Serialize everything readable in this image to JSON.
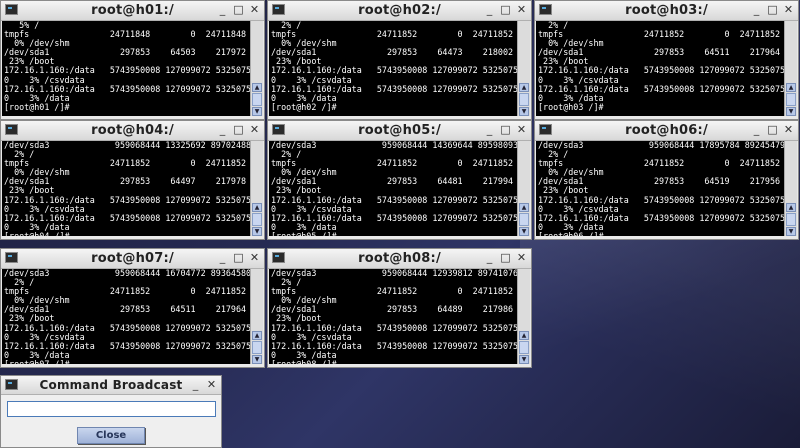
{
  "terminals": [
    {
      "title": "root@h01:/",
      "lines": [
        "   5% /",
        "tmpfs                24711848        0  24711848",
        "  0% /dev/shm",
        "/dev/sda1              297853    64503    217972",
        " 23% /boot",
        "172.16.1.160:/data   5743950008 127099072 532507504",
        "0    3% /csvdata",
        "172.16.1.160:/data   5743950008 127099072 532507504",
        "0    3% /data",
        "[root@h01 /]#"
      ]
    },
    {
      "title": "root@h02:/",
      "lines": [
        "  2% /",
        "tmpfs                24711852        0  24711852",
        "  0% /dev/shm",
        "/dev/sda1              297853    64473    218002",
        " 23% /boot",
        "172.16.1.160:/data   5743950008 127099072 532507504",
        "0    3% /csvdata",
        "172.16.1.160:/data   5743950008 127099072 532507504",
        "0    3% /data",
        "[root@h02 /]#"
      ]
    },
    {
      "title": "root@h03:/",
      "lines": [
        "  2% /",
        "tmpfs                24711852        0  24711852",
        "  0% /dev/shm",
        "/dev/sda1              297853    64511    217964",
        " 23% /boot",
        "172.16.1.160:/data   5743950008 127099072 532507504",
        "0    3% /csvdata",
        "172.16.1.160:/data   5743950008 127099072 532507504",
        "0    3% /data",
        "[root@h03 /]#"
      ]
    },
    {
      "title": "root@h04:/",
      "lines": [
        "/dev/sda3             959068444 13325692 897024888",
        "  2% /",
        "tmpfs                24711852        0  24711852",
        "  0% /dev/shm",
        "/dev/sda1              297853    64497    217978",
        " 23% /boot",
        "172.16.1.160:/data   5743950008 127099072 532507504",
        "0    3% /csvdata",
        "172.16.1.160:/data   5743950008 127099072 532507504",
        "0    3% /data",
        "[root@h04 /]#"
      ]
    },
    {
      "title": "root@h05:/",
      "lines": [
        "/dev/sda3             959068444 14369644 895980936",
        "  2% /",
        "tmpfs                24711852        0  24711852",
        "  0% /dev/shm",
        "/dev/sda1              297853    64481    217994",
        " 23% /boot",
        "172.16.1.160:/data   5743950008 127099072 532507504",
        "0    3% /csvdata",
        "172.16.1.160:/data   5743950008 127099072 532507504",
        "0    3% /data",
        "[root@h05 /]#"
      ]
    },
    {
      "title": "root@h06:/",
      "lines": [
        "/dev/sda3             959068444 17895784 892454796",
        "  2% /",
        "tmpfs                24711852        0  24711852",
        "  0% /dev/shm",
        "/dev/sda1              297853    64519    217956",
        " 23% /boot",
        "172.16.1.160:/data   5743950008 127099072 532507504",
        "0    3% /csvdata",
        "172.16.1.160:/data   5743950008 127099072 532507504",
        "0    3% /data",
        "[root@h06 /]#"
      ]
    },
    {
      "title": "root@h07:/",
      "lines": [
        "/dev/sda3             959068444 16704772 893645808",
        "  2% /",
        "tmpfs                24711852        0  24711852",
        "  0% /dev/shm",
        "/dev/sda1              297853    64511    217964",
        " 23% /boot",
        "172.16.1.160:/data   5743950008 127099072 532507504",
        "0    3% /csvdata",
        "172.16.1.160:/data   5743950008 127099072 532507504",
        "0    3% /data",
        "[root@h07 /]#"
      ]
    },
    {
      "title": "root@h08:/",
      "lines": [
        "/dev/sda3             959068444 12939812 897410768",
        "  2% /",
        "tmpfs                24711852        0  24711852",
        "  0% /dev/shm",
        "/dev/sda1              297853    64489    217986",
        " 23% /boot",
        "172.16.1.160:/data   5743950008 127099072 532507504",
        "0    3% /csvdata",
        "172.16.1.160:/data   5743950008 127099072 532507504",
        "0    3% /data",
        "[root@h08 /]#"
      ]
    }
  ],
  "window_controls": {
    "minimize": "_",
    "maximize": "□",
    "close": "✕"
  },
  "broadcast": {
    "title": "Command Broadcast",
    "input_value": "",
    "close_label": "Close"
  },
  "icons": {
    "terminal": "terminal-icon",
    "scroll_up": "▲",
    "scroll_down": "▼"
  },
  "colors": {
    "desktop": "#262a52",
    "terminal_bg": "#000000",
    "terminal_fg": "#ffffff",
    "button": "#b4c4e4"
  }
}
